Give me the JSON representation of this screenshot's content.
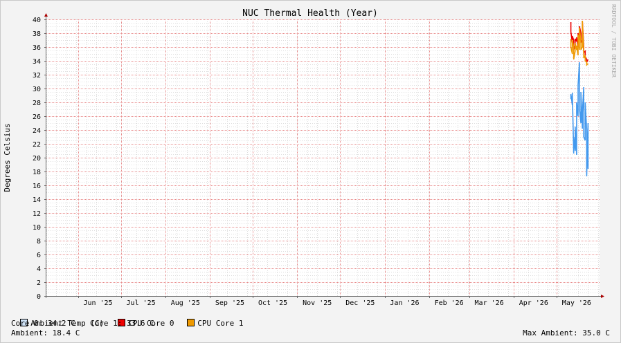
{
  "chart_data": {
    "type": "line",
    "title": "NUC Thermal Health (Year)",
    "ylabel": "Degrees Celsius",
    "xlabel": "",
    "watermark": "RRDTOOL / TOBI OETIKER",
    "ylim": [
      0,
      40
    ],
    "yticks": [
      0,
      2,
      4,
      6,
      8,
      10,
      12,
      14,
      16,
      18,
      20,
      22,
      24,
      26,
      28,
      30,
      32,
      34,
      36,
      38,
      40
    ],
    "xlim": [
      "2025-05-10",
      "2026-05-31"
    ],
    "xticks": [
      {
        "label": "Jun '25",
        "date": "2025-06-15"
      },
      {
        "label": "Jul '25",
        "date": "2025-07-15"
      },
      {
        "label": "Aug '25",
        "date": "2025-08-15"
      },
      {
        "label": "Sep '25",
        "date": "2025-09-15"
      },
      {
        "label": "Oct '25",
        "date": "2025-10-15"
      },
      {
        "label": "Nov '25",
        "date": "2025-11-15"
      },
      {
        "label": "Dec '25",
        "date": "2025-12-15"
      },
      {
        "label": "Jan '26",
        "date": "2026-01-15"
      },
      {
        "label": "Feb '26",
        "date": "2026-02-15"
      },
      {
        "label": "Mar '26",
        "date": "2026-03-15"
      },
      {
        "label": "Apr '26",
        "date": "2026-04-15"
      },
      {
        "label": "May '26",
        "date": "2026-05-15"
      }
    ],
    "grid": true,
    "series": [
      {
        "name": "Ambient Temp (C)",
        "color": "#4499ee",
        "points": [
          [
            "2026-05-11",
            28.5
          ],
          [
            "2026-05-11",
            29.2
          ],
          [
            "2026-05-12",
            27.6
          ],
          [
            "2026-05-12",
            29.4
          ],
          [
            "2026-05-13",
            20.6
          ],
          [
            "2026-05-13",
            23.0
          ],
          [
            "2026-05-14",
            21.0
          ],
          [
            "2026-05-14",
            24.5
          ],
          [
            "2026-05-15",
            20.4
          ],
          [
            "2026-05-15",
            28.0
          ],
          [
            "2026-05-16",
            26.0
          ],
          [
            "2026-05-16",
            30.5
          ],
          [
            "2026-05-17",
            33.8
          ],
          [
            "2026-05-17",
            27.0
          ],
          [
            "2026-05-18",
            25.0
          ],
          [
            "2026-05-18",
            29.5
          ],
          [
            "2026-05-19",
            24.2
          ],
          [
            "2026-05-19",
            26.5
          ],
          [
            "2026-05-20",
            30.2
          ],
          [
            "2026-05-20",
            23.0
          ],
          [
            "2026-05-21",
            22.5
          ],
          [
            "2026-05-21",
            28.0
          ],
          [
            "2026-05-22",
            24.0
          ],
          [
            "2026-05-22",
            17.3
          ],
          [
            "2026-05-23",
            25.0
          ],
          [
            "2026-05-23",
            18.4
          ]
        ]
      },
      {
        "name": "CPU Core 0",
        "color": "#ee0000",
        "points": [
          [
            "2026-05-11",
            39.6
          ],
          [
            "2026-05-11",
            38.2
          ],
          [
            "2026-05-12",
            36.6
          ],
          [
            "2026-05-12",
            37.6
          ],
          [
            "2026-05-13",
            37.0
          ],
          [
            "2026-05-13",
            35.6
          ],
          [
            "2026-05-14",
            36.2
          ],
          [
            "2026-05-14",
            37.2
          ],
          [
            "2026-05-15",
            36.8
          ],
          [
            "2026-05-15",
            37.4
          ],
          [
            "2026-05-16",
            36.0
          ],
          [
            "2026-05-16",
            38.0
          ],
          [
            "2026-05-17",
            37.0
          ],
          [
            "2026-05-17",
            39.0
          ],
          [
            "2026-05-18",
            38.0
          ],
          [
            "2026-05-18",
            36.6
          ],
          [
            "2026-05-19",
            37.0
          ],
          [
            "2026-05-19",
            39.8
          ],
          [
            "2026-05-20",
            36.0
          ],
          [
            "2026-05-20",
            35.2
          ],
          [
            "2026-05-21",
            35.4
          ],
          [
            "2026-05-21",
            34.6
          ],
          [
            "2026-05-22",
            34.2
          ],
          [
            "2026-05-22",
            33.8
          ],
          [
            "2026-05-23",
            34.2
          ]
        ]
      },
      {
        "name": "CPU Core 1",
        "color": "#ee9900",
        "points": [
          [
            "2026-05-11",
            37.2
          ],
          [
            "2026-05-11",
            36.0
          ],
          [
            "2026-05-12",
            35.0
          ],
          [
            "2026-05-12",
            37.0
          ],
          [
            "2026-05-13",
            36.0
          ],
          [
            "2026-05-13",
            34.2
          ],
          [
            "2026-05-14",
            35.4
          ],
          [
            "2026-05-14",
            36.6
          ],
          [
            "2026-05-15",
            35.6
          ],
          [
            "2026-05-15",
            36.2
          ],
          [
            "2026-05-16",
            34.8
          ],
          [
            "2026-05-16",
            37.8
          ],
          [
            "2026-05-17",
            35.6
          ],
          [
            "2026-05-17",
            38.8
          ],
          [
            "2026-05-18",
            36.6
          ],
          [
            "2026-05-18",
            35.6
          ],
          [
            "2026-05-19",
            36.0
          ],
          [
            "2026-05-19",
            39.8
          ],
          [
            "2026-05-20",
            35.0
          ],
          [
            "2026-05-20",
            34.4
          ],
          [
            "2026-05-21",
            34.8
          ],
          [
            "2026-05-21",
            34.0
          ],
          [
            "2026-05-22",
            33.8
          ],
          [
            "2026-05-22",
            33.4
          ],
          [
            "2026-05-23",
            33.6
          ]
        ]
      }
    ]
  },
  "status": {
    "core0": "Core 0: 34.2 C",
    "core1": "Core 1: 33.6 C",
    "ambient": "Ambient: 18.4 C",
    "max_ambient": "Max Ambient: 35.0 C"
  },
  "colors": {
    "background": "#f3f3f3",
    "canvas": "#ffffff",
    "minor_grid": "#dddddd",
    "major_grid": "#e88b8b",
    "axis": "#666666"
  }
}
